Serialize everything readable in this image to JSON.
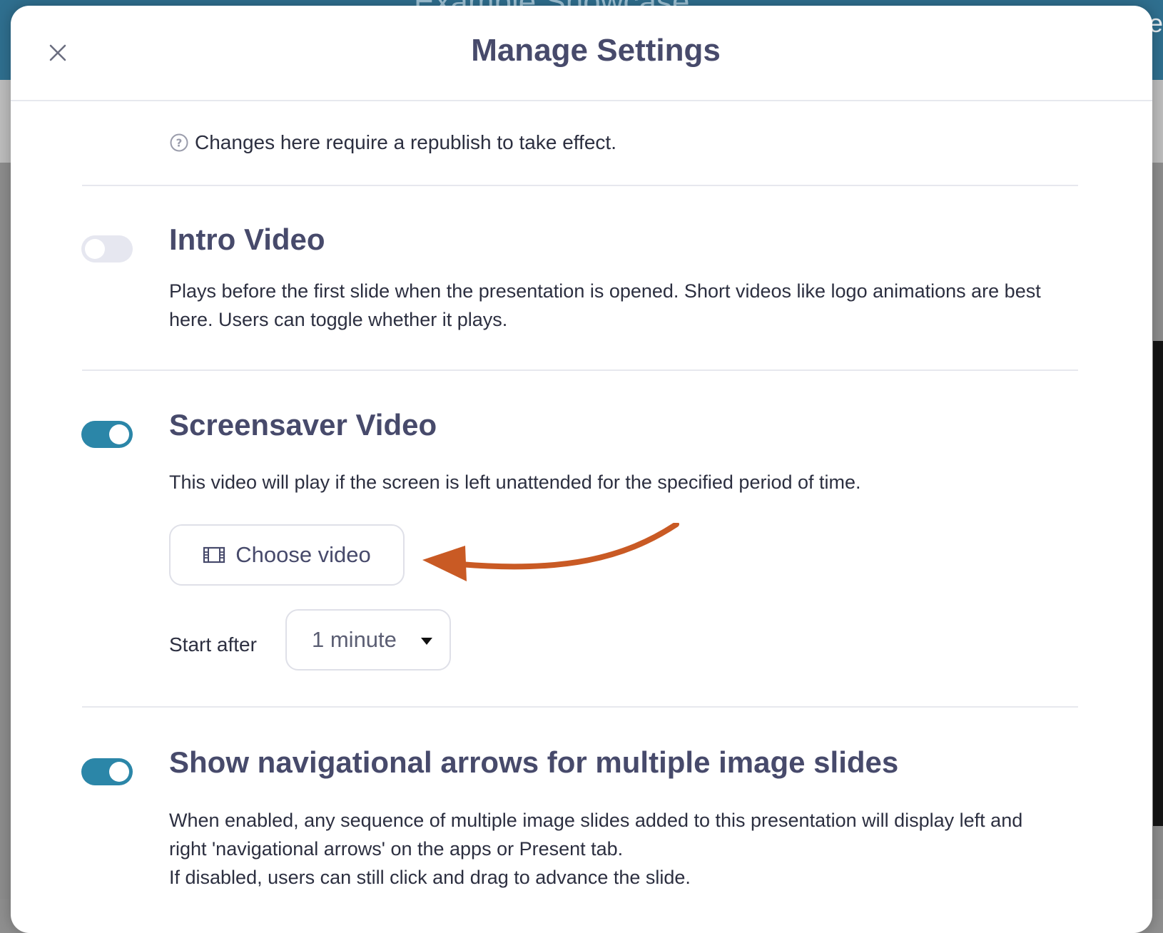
{
  "background": {
    "app_title": "Example Showcase",
    "right_text": "re"
  },
  "modal": {
    "title": "Manage Settings",
    "notice": "Changes here require a republish to take effect."
  },
  "sections": [
    {
      "title": "Intro Video",
      "enabled": false,
      "description": "Plays before the first slide when the presentation is opened. Short videos like logo animations are best here. Users can toggle whether it plays."
    },
    {
      "title": "Screensaver Video",
      "enabled": true,
      "description": "This video will play if the screen is left unattended for the specified period of time.",
      "choose_video_label": "Choose video",
      "start_after_label": "Start after",
      "start_after_value": "1 minute"
    },
    {
      "title": "Show navigational arrows for multiple image slides",
      "enabled": true,
      "description_line1": "When enabled, any sequence of multiple image slides added to this presentation will display left and right 'navigational arrows' on the apps or Present tab.",
      "description_line2": "If disabled, users can still click and drag to advance the slide."
    }
  ],
  "colors": {
    "accent": "#2b86a8",
    "toggle_off": "#e6e7f0",
    "title_text": "#474a6b",
    "body_text": "#2c2f40",
    "annotation_arrow": "#c95a24"
  },
  "icons": {
    "close": "close-icon",
    "help": "question-circle-icon",
    "film": "film-icon",
    "dropdown": "caret-down-icon"
  }
}
